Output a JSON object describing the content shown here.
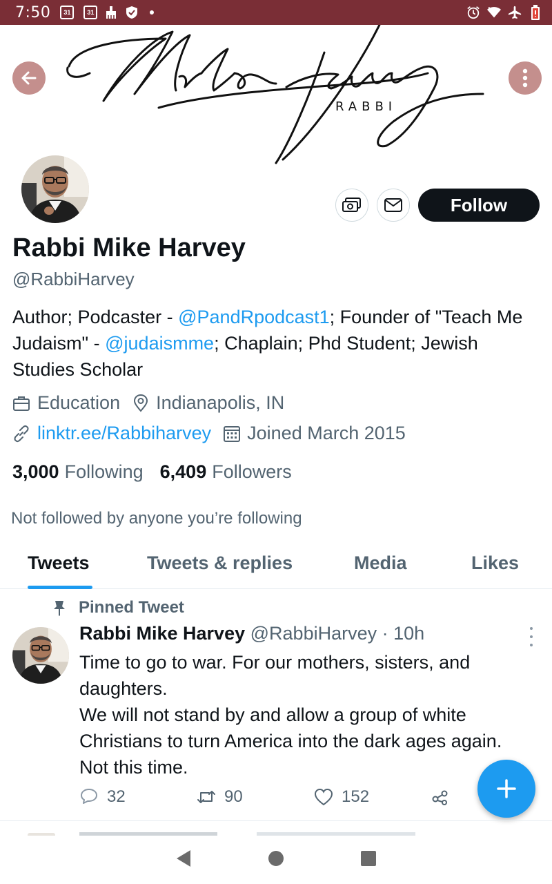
{
  "status_bar": {
    "time": "7:50",
    "calendar_day_1": "31",
    "calendar_day_2": "31",
    "icons_left": [
      "calendar-icon",
      "calendar-icon",
      "cleaning-icon",
      "shield-icon",
      "dot-icon"
    ],
    "icons_right": [
      "alarm-icon",
      "wifi-icon",
      "airplane-icon",
      "battery-icon"
    ]
  },
  "banner": {
    "signature_text": "Mike Harvey",
    "logo_subtitle": "RABBI"
  },
  "profile": {
    "follow_label": "Follow",
    "display_name": "Rabbi Mike Harvey",
    "handle": "@RabbiHarvey",
    "bio": {
      "part1": "Author; Podcaster - ",
      "mention1": "@PandRpodcast1",
      "part2": "; Founder of \"Teach Me Judaism\" - ",
      "mention2": "@judaismme",
      "part3": "; Chaplain; Phd Student; Jewish Studies Scholar"
    },
    "category": "Education",
    "location": "Indianapolis, IN",
    "website": "linktr.ee/Rabbiharvey",
    "joined": "Joined March 2015",
    "following_count": "3,000",
    "following_label": "Following",
    "followers_count": "6,409",
    "followers_label": "Followers",
    "not_followed_text": "Not followed by anyone you’re following"
  },
  "tabs": [
    {
      "label": "Tweets",
      "active": true
    },
    {
      "label": "Tweets & replies",
      "active": false
    },
    {
      "label": "Media",
      "active": false
    },
    {
      "label": "Likes",
      "active": false
    }
  ],
  "tweet": {
    "pinned_label": "Pinned Tweet",
    "author_name": "Rabbi Mike Harvey",
    "author_handle": "@RabbiHarvey",
    "separator": " · ",
    "time": "10h",
    "text": "Time to go to war.  For our mothers, sisters, and daughters.\nWe will not stand by and allow a group of white Christians to turn America into the dark ages again.\nNot this time.",
    "replies": "32",
    "retweets": "90",
    "likes": "152"
  },
  "colors": {
    "status_bar": "#7a2e36",
    "accent": "#1d9bf0",
    "text_primary": "#0f1419",
    "text_secondary": "#536471",
    "banner_button": "#c48f8d"
  }
}
